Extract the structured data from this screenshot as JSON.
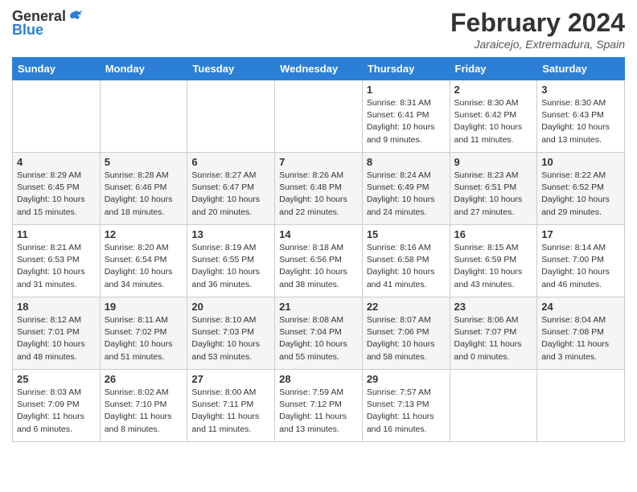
{
  "header": {
    "logo_general": "General",
    "logo_blue": "Blue",
    "month_title": "February 2024",
    "location": "Jaraicejo, Extremadura, Spain"
  },
  "days_of_week": [
    "Sunday",
    "Monday",
    "Tuesday",
    "Wednesday",
    "Thursday",
    "Friday",
    "Saturday"
  ],
  "weeks": [
    [
      {
        "day": "",
        "info": ""
      },
      {
        "day": "",
        "info": ""
      },
      {
        "day": "",
        "info": ""
      },
      {
        "day": "",
        "info": ""
      },
      {
        "day": "1",
        "info": "Sunrise: 8:31 AM\nSunset: 6:41 PM\nDaylight: 10 hours and 9 minutes."
      },
      {
        "day": "2",
        "info": "Sunrise: 8:30 AM\nSunset: 6:42 PM\nDaylight: 10 hours and 11 minutes."
      },
      {
        "day": "3",
        "info": "Sunrise: 8:30 AM\nSunset: 6:43 PM\nDaylight: 10 hours and 13 minutes."
      }
    ],
    [
      {
        "day": "4",
        "info": "Sunrise: 8:29 AM\nSunset: 6:45 PM\nDaylight: 10 hours and 15 minutes."
      },
      {
        "day": "5",
        "info": "Sunrise: 8:28 AM\nSunset: 6:46 PM\nDaylight: 10 hours and 18 minutes."
      },
      {
        "day": "6",
        "info": "Sunrise: 8:27 AM\nSunset: 6:47 PM\nDaylight: 10 hours and 20 minutes."
      },
      {
        "day": "7",
        "info": "Sunrise: 8:26 AM\nSunset: 6:48 PM\nDaylight: 10 hours and 22 minutes."
      },
      {
        "day": "8",
        "info": "Sunrise: 8:24 AM\nSunset: 6:49 PM\nDaylight: 10 hours and 24 minutes."
      },
      {
        "day": "9",
        "info": "Sunrise: 8:23 AM\nSunset: 6:51 PM\nDaylight: 10 hours and 27 minutes."
      },
      {
        "day": "10",
        "info": "Sunrise: 8:22 AM\nSunset: 6:52 PM\nDaylight: 10 hours and 29 minutes."
      }
    ],
    [
      {
        "day": "11",
        "info": "Sunrise: 8:21 AM\nSunset: 6:53 PM\nDaylight: 10 hours and 31 minutes."
      },
      {
        "day": "12",
        "info": "Sunrise: 8:20 AM\nSunset: 6:54 PM\nDaylight: 10 hours and 34 minutes."
      },
      {
        "day": "13",
        "info": "Sunrise: 8:19 AM\nSunset: 6:55 PM\nDaylight: 10 hours and 36 minutes."
      },
      {
        "day": "14",
        "info": "Sunrise: 8:18 AM\nSunset: 6:56 PM\nDaylight: 10 hours and 38 minutes."
      },
      {
        "day": "15",
        "info": "Sunrise: 8:16 AM\nSunset: 6:58 PM\nDaylight: 10 hours and 41 minutes."
      },
      {
        "day": "16",
        "info": "Sunrise: 8:15 AM\nSunset: 6:59 PM\nDaylight: 10 hours and 43 minutes."
      },
      {
        "day": "17",
        "info": "Sunrise: 8:14 AM\nSunset: 7:00 PM\nDaylight: 10 hours and 46 minutes."
      }
    ],
    [
      {
        "day": "18",
        "info": "Sunrise: 8:12 AM\nSunset: 7:01 PM\nDaylight: 10 hours and 48 minutes."
      },
      {
        "day": "19",
        "info": "Sunrise: 8:11 AM\nSunset: 7:02 PM\nDaylight: 10 hours and 51 minutes."
      },
      {
        "day": "20",
        "info": "Sunrise: 8:10 AM\nSunset: 7:03 PM\nDaylight: 10 hours and 53 minutes."
      },
      {
        "day": "21",
        "info": "Sunrise: 8:08 AM\nSunset: 7:04 PM\nDaylight: 10 hours and 55 minutes."
      },
      {
        "day": "22",
        "info": "Sunrise: 8:07 AM\nSunset: 7:06 PM\nDaylight: 10 hours and 58 minutes."
      },
      {
        "day": "23",
        "info": "Sunrise: 8:06 AM\nSunset: 7:07 PM\nDaylight: 11 hours and 0 minutes."
      },
      {
        "day": "24",
        "info": "Sunrise: 8:04 AM\nSunset: 7:08 PM\nDaylight: 11 hours and 3 minutes."
      }
    ],
    [
      {
        "day": "25",
        "info": "Sunrise: 8:03 AM\nSunset: 7:09 PM\nDaylight: 11 hours and 6 minutes."
      },
      {
        "day": "26",
        "info": "Sunrise: 8:02 AM\nSunset: 7:10 PM\nDaylight: 11 hours and 8 minutes."
      },
      {
        "day": "27",
        "info": "Sunrise: 8:00 AM\nSunset: 7:11 PM\nDaylight: 11 hours and 11 minutes."
      },
      {
        "day": "28",
        "info": "Sunrise: 7:59 AM\nSunset: 7:12 PM\nDaylight: 11 hours and 13 minutes."
      },
      {
        "day": "29",
        "info": "Sunrise: 7:57 AM\nSunset: 7:13 PM\nDaylight: 11 hours and 16 minutes."
      },
      {
        "day": "",
        "info": ""
      },
      {
        "day": "",
        "info": ""
      }
    ]
  ]
}
